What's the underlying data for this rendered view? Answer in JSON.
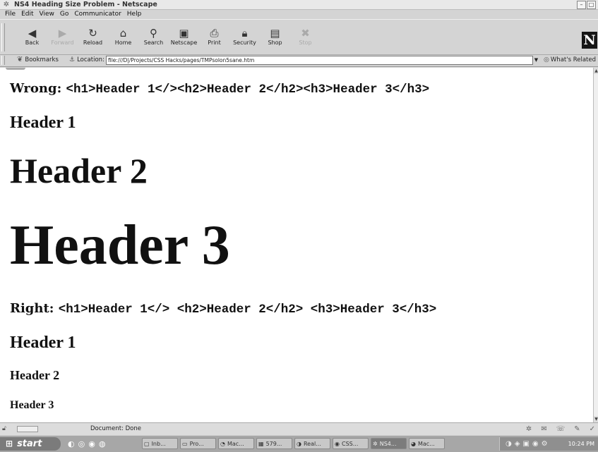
{
  "window": {
    "title": "NS4 Heading Size Problem - Netscape",
    "icon": "netscape-window-icon",
    "buttons": [
      "minimize",
      "maximize"
    ]
  },
  "menubar": [
    {
      "label": "File"
    },
    {
      "label": "Edit"
    },
    {
      "label": "View"
    },
    {
      "label": "Go"
    },
    {
      "label": "Communicator"
    },
    {
      "label": "Help"
    }
  ],
  "toolbar": {
    "buttons": [
      {
        "label": "Back",
        "icon": "back-icon",
        "enabled": true
      },
      {
        "label": "Forward",
        "icon": "forward-icon",
        "enabled": false
      },
      {
        "label": "Reload",
        "icon": "reload-icon",
        "enabled": true
      },
      {
        "label": "Home",
        "icon": "home-icon",
        "enabled": true
      },
      {
        "label": "Search",
        "icon": "search-icon",
        "enabled": true
      },
      {
        "label": "Netscape",
        "icon": "netscape-icon",
        "enabled": true
      },
      {
        "label": "Print",
        "icon": "print-icon",
        "enabled": true
      },
      {
        "label": "Security",
        "icon": "security-lock-icon",
        "enabled": true
      },
      {
        "label": "Shop",
        "icon": "shop-icon",
        "enabled": true
      },
      {
        "label": "Stop",
        "icon": "stop-icon",
        "enabled": false
      }
    ],
    "logo": "N"
  },
  "location": {
    "bookmarks_label": "Bookmarks",
    "location_label": "Location:",
    "url": "file:///D|/Projects/CSS Hacks/pages/TMPsolon5sane.htm",
    "related_label": "What's Related"
  },
  "content": {
    "wrong": {
      "label": "Wrong:",
      "code": "<h1>Header 1</><h2>Header 2</h2><h3>Header 3</h3>",
      "h1": "Header 1",
      "h2": "Header 2",
      "h3": "Header 3"
    },
    "right": {
      "label": "Right:",
      "code": "<h1>Header 1</> <h2>Header 2</h2> <h3>Header 3</h3>",
      "h1": "Header 1",
      "h2": "Header 2",
      "h3": "Header 3"
    }
  },
  "status": {
    "text": "Document: Done"
  },
  "taskbar": {
    "start_label": "start",
    "tasks": [
      {
        "label": "Inb...",
        "active": false
      },
      {
        "label": "Pro...",
        "active": false
      },
      {
        "label": "Mac...",
        "active": false
      },
      {
        "label": "579...",
        "active": false
      },
      {
        "label": "Real...",
        "active": false
      },
      {
        "label": "CSS...",
        "active": false
      },
      {
        "label": "NS4...",
        "active": true
      },
      {
        "label": "Mac...",
        "active": false
      }
    ],
    "clock": "10:24 PM"
  },
  "colors": {
    "page_background": "#ffffff",
    "chrome": "#d4d4d4",
    "taskbar": "#a7a7a7"
  }
}
